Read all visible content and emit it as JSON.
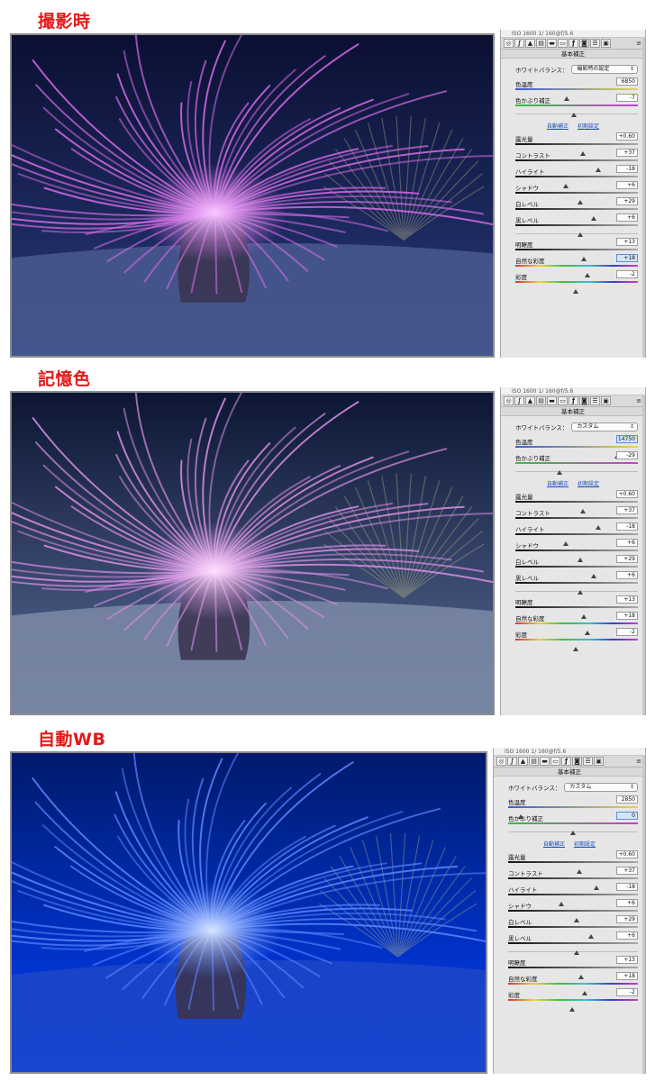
{
  "colors": {
    "heading": "#e51818",
    "panel_bg": "#e6e6e6",
    "highlight_field": "#d4e4fb",
    "link": "#1c4fb8",
    "temp_gradient": [
      "#3a5bd9",
      "#e7d84b"
    ],
    "tint_gradient": [
      "#35c23b",
      "#d13bd1"
    ],
    "sat_gradient": [
      "#d33",
      "#e8d538",
      "#35c23b",
      "#34c2d2",
      "#3b3bd3",
      "#d13bd1"
    ]
  },
  "icons": [
    "settings-icon",
    "curve-icon",
    "mountain-icon",
    "hsl-icon",
    "split-tone-icon",
    "detail-icon",
    "fx-icon",
    "camera-icon",
    "preset-icon",
    "snapshot-icon",
    "menu-icon"
  ],
  "panels": [
    {
      "heading": "撮影時",
      "info_strip": "ISO 1600   1/ 160@f/5.6",
      "section_title": "基本補正",
      "wb_label": "ホワイトバランス：",
      "wb_value": "撮影時の設定",
      "links": [
        "自動補正",
        "初期設定"
      ],
      "sliders": [
        {
          "key": "temp",
          "label": "色温度",
          "value": "6850",
          "pos": 0.42,
          "track": "temp",
          "highlight": false
        },
        {
          "key": "tint",
          "label": "色かぶり補正",
          "value": "-7",
          "pos": 0.48,
          "track": "tint",
          "highlight": false
        },
        {
          "key": "exposure",
          "label": "露光量",
          "value": "+0.60",
          "pos": 0.55,
          "track": "dark",
          "highlight": false
        },
        {
          "key": "contrast",
          "label": "コントラスト",
          "value": "+37",
          "pos": 0.68,
          "track": "dark",
          "highlight": false
        },
        {
          "key": "highlights",
          "label": "ハイライト",
          "value": "-18",
          "pos": 0.41,
          "track": "dark",
          "highlight": false
        },
        {
          "key": "shadows",
          "label": "シャドウ",
          "value": "+6",
          "pos": 0.53,
          "track": "dark",
          "highlight": false
        },
        {
          "key": "whites",
          "label": "白レベル",
          "value": "+29",
          "pos": 0.64,
          "track": "dark",
          "highlight": false
        },
        {
          "key": "blacks",
          "label": "黒レベル",
          "value": "+6",
          "pos": 0.53,
          "track": "dark",
          "highlight": false
        },
        {
          "key": "clarity",
          "label": "明瞭度",
          "value": "+13",
          "pos": 0.56,
          "track": "dark",
          "highlight": false
        },
        {
          "key": "vibrance",
          "label": "自然な彩度",
          "value": "+18",
          "pos": 0.59,
          "track": "sat",
          "highlight": true
        },
        {
          "key": "saturation",
          "label": "彩度",
          "value": "-2",
          "pos": 0.49,
          "track": "sat",
          "highlight": false
        }
      ]
    },
    {
      "heading": "記憶色",
      "info_strip": "ISO 1600   1/ 160@f/5.6",
      "section_title": "基本補正",
      "wb_label": "ホワイトバランス：",
      "wb_value": "カスタム",
      "links": [
        "自動補正",
        "初期設定"
      ],
      "sliders": [
        {
          "key": "temp",
          "label": "色温度",
          "value": "14750",
          "pos": 0.83,
          "track": "temp",
          "highlight": true
        },
        {
          "key": "tint",
          "label": "色かぶり補正",
          "value": "-29",
          "pos": 0.36,
          "track": "tint",
          "highlight": false
        },
        {
          "key": "exposure",
          "label": "露光量",
          "value": "+0.60",
          "pos": 0.55,
          "track": "dark",
          "highlight": false
        },
        {
          "key": "contrast",
          "label": "コントラスト",
          "value": "+37",
          "pos": 0.68,
          "track": "dark",
          "highlight": false
        },
        {
          "key": "highlights",
          "label": "ハイライト",
          "value": "-18",
          "pos": 0.41,
          "track": "dark",
          "highlight": false
        },
        {
          "key": "shadows",
          "label": "シャドウ",
          "value": "+6",
          "pos": 0.53,
          "track": "dark",
          "highlight": false
        },
        {
          "key": "whites",
          "label": "白レベル",
          "value": "+29",
          "pos": 0.64,
          "track": "dark",
          "highlight": false
        },
        {
          "key": "blacks",
          "label": "黒レベル",
          "value": "+6",
          "pos": 0.53,
          "track": "dark",
          "highlight": false
        },
        {
          "key": "clarity",
          "label": "明瞭度",
          "value": "+13",
          "pos": 0.56,
          "track": "dark",
          "highlight": false
        },
        {
          "key": "vibrance",
          "label": "自然な彩度",
          "value": "+18",
          "pos": 0.59,
          "track": "sat",
          "highlight": false
        },
        {
          "key": "saturation",
          "label": "彩度",
          "value": "-2",
          "pos": 0.49,
          "track": "sat",
          "highlight": false
        }
      ]
    },
    {
      "heading": "自動WB",
      "info_strip": "ISO 1600   1/ 160@f/5.6",
      "section_title": "基本補正",
      "wb_label": "ホワイトバランス：",
      "wb_value": "カスタム",
      "links": [
        "自動補正",
        "初期設定"
      ],
      "sliders": [
        {
          "key": "temp",
          "label": "色温度",
          "value": "2850",
          "pos": 0.1,
          "track": "temp",
          "highlight": false
        },
        {
          "key": "tint",
          "label": "色かぶり補正",
          "value": "0",
          "pos": 0.5,
          "track": "tint",
          "highlight": true
        },
        {
          "key": "exposure",
          "label": "露光量",
          "value": "+0.60",
          "pos": 0.55,
          "track": "dark",
          "highlight": false
        },
        {
          "key": "contrast",
          "label": "コントラスト",
          "value": "+37",
          "pos": 0.68,
          "track": "dark",
          "highlight": false
        },
        {
          "key": "highlights",
          "label": "ハイライト",
          "value": "-18",
          "pos": 0.41,
          "track": "dark",
          "highlight": false
        },
        {
          "key": "shadows",
          "label": "シャドウ",
          "value": "+6",
          "pos": 0.53,
          "track": "dark",
          "highlight": false
        },
        {
          "key": "whites",
          "label": "白レベル",
          "value": "+29",
          "pos": 0.64,
          "track": "dark",
          "highlight": false
        },
        {
          "key": "blacks",
          "label": "黒レベル",
          "value": "+6",
          "pos": 0.53,
          "track": "dark",
          "highlight": false
        },
        {
          "key": "clarity",
          "label": "明瞭度",
          "value": "+13",
          "pos": 0.56,
          "track": "dark",
          "highlight": false
        },
        {
          "key": "vibrance",
          "label": "自然な彩度",
          "value": "+18",
          "pos": 0.59,
          "track": "sat",
          "highlight": false
        },
        {
          "key": "saturation",
          "label": "彩度",
          "value": "-2",
          "pos": 0.49,
          "track": "sat",
          "highlight": false
        }
      ]
    }
  ],
  "photos": [
    {
      "tone": "night-purple",
      "bg": [
        "#0b1032",
        "#283a7a"
      ],
      "anemone": "#d46be6",
      "glow": "#f7c8ff",
      "sand": "#4a5a90"
    },
    {
      "tone": "memory-pink",
      "bg": [
        "#0c1633",
        "#5a6c98"
      ],
      "anemone": "#d98ee4",
      "glow": "#ffe1ff",
      "sand": "#7c8aa7"
    },
    {
      "tone": "auto-blue",
      "bg": [
        "#001a6b",
        "#0040ff"
      ],
      "anemone": "#5b86ff",
      "glow": "#d9e6ff",
      "sand": "#1d46c7"
    }
  ]
}
